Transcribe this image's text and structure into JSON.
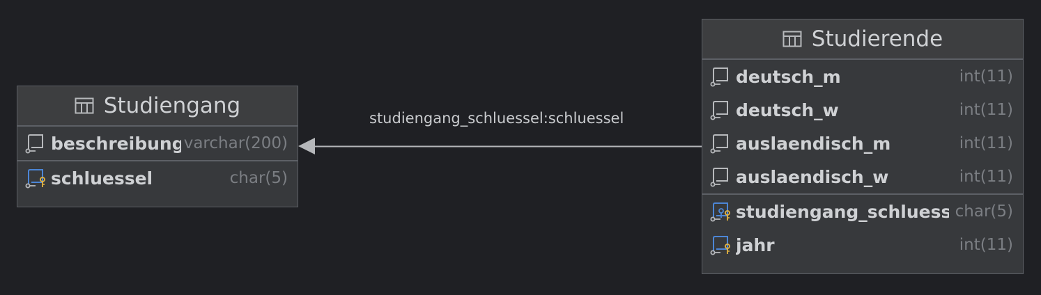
{
  "entities": {
    "studiengang": {
      "title": "Studiengang",
      "columns": [
        {
          "name": "beschreibung",
          "type": "varchar(200)",
          "key": "none"
        },
        {
          "name": "schluessel",
          "type": "char(5)",
          "key": "primary"
        }
      ]
    },
    "studierende": {
      "title": "Studierende",
      "columns": [
        {
          "name": "deutsch_m",
          "type": "int(11)",
          "key": "none"
        },
        {
          "name": "deutsch_w",
          "type": "int(11)",
          "key": "none"
        },
        {
          "name": "auslaendisch_m",
          "type": "int(11)",
          "key": "none"
        },
        {
          "name": "auslaendisch_w",
          "type": "int(11)",
          "key": "none"
        },
        {
          "name": "studiengang_schluessel",
          "type": "char(5)",
          "key": "primary-foreign"
        },
        {
          "name": "jahr",
          "type": "int(11)",
          "key": "primary"
        }
      ]
    }
  },
  "relationship": {
    "label": "studiengang_schluessel:schluessel"
  },
  "colors": {
    "background": "#1f2024",
    "entity_fill": "#37393c",
    "border": "#5d6066",
    "text": "#cfd1d4",
    "type_text": "#7b7e83",
    "primary_key_icon": "#e3b341",
    "foreign_key_icon": "#4c86d6",
    "connector": "#b5b7ba"
  }
}
